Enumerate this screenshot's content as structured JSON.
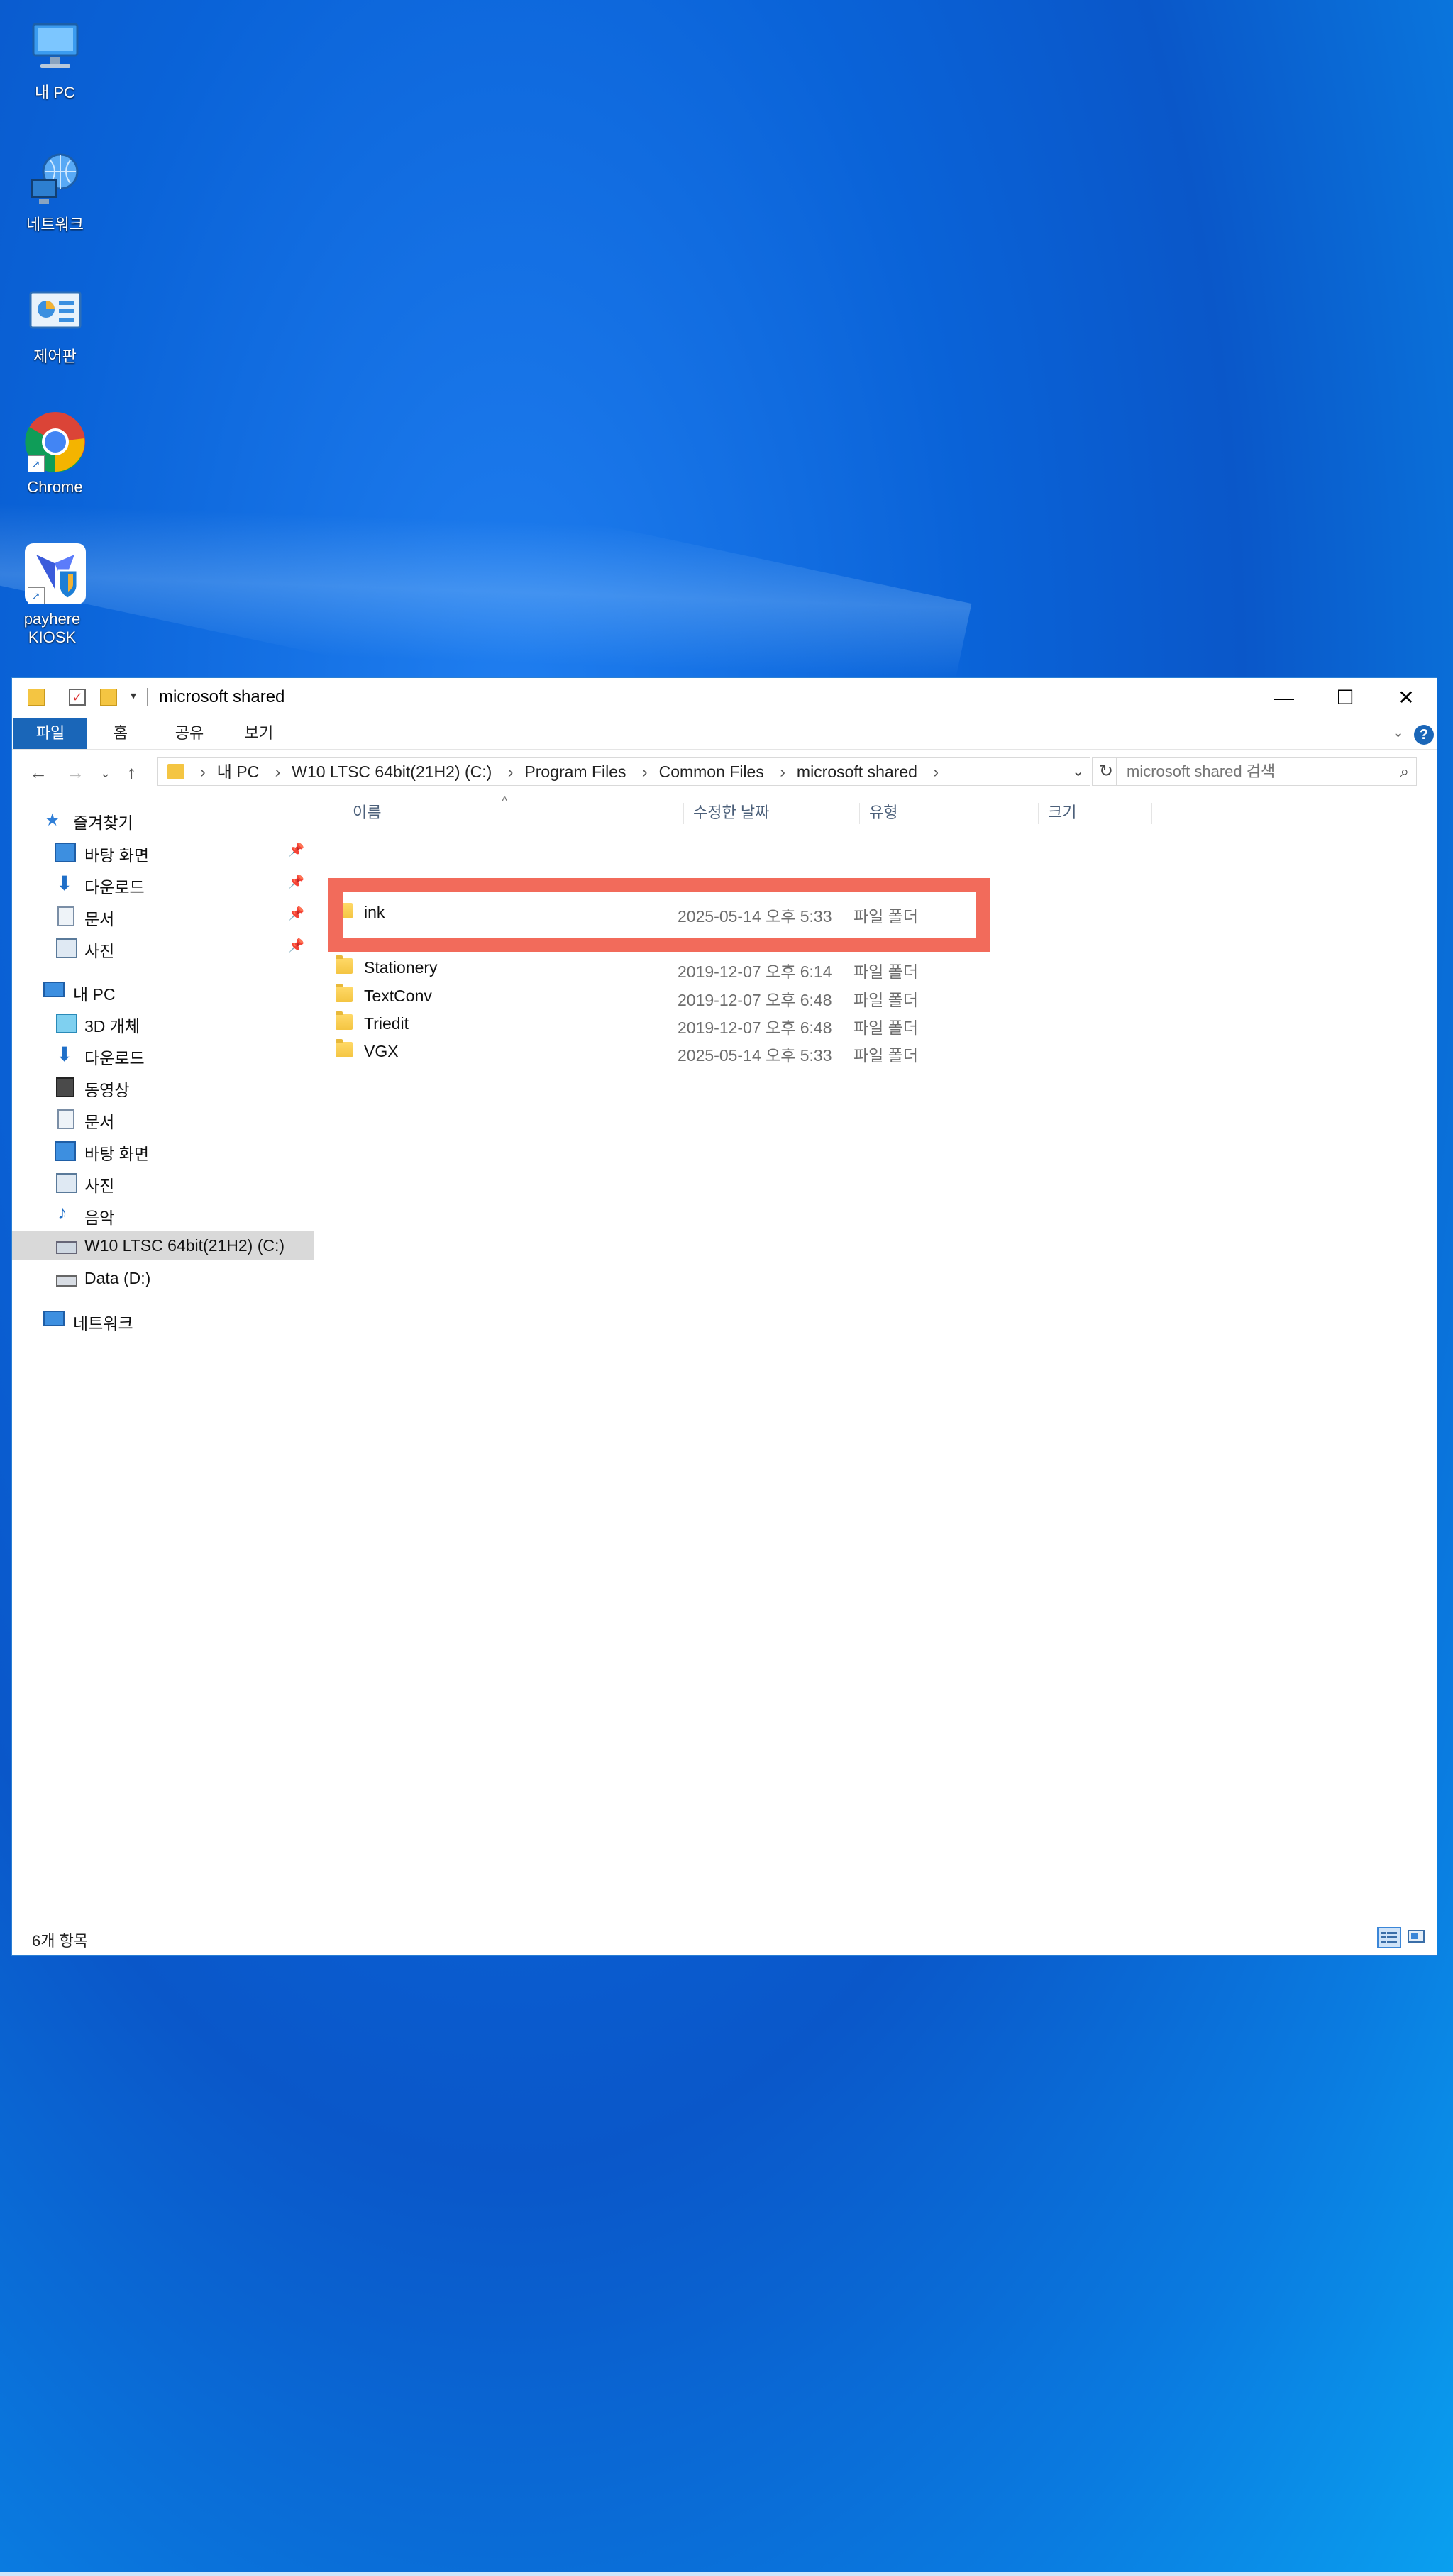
{
  "desktop": {
    "icons": [
      {
        "label": "내 PC"
      },
      {
        "label": "네트워크"
      },
      {
        "label": "제어판"
      },
      {
        "label": "Chrome"
      },
      {
        "label": "payhere KIOSK"
      }
    ]
  },
  "window": {
    "title": "microsoft shared",
    "ribbon_tabs": [
      "파일",
      "홈",
      "공유",
      "보기"
    ],
    "help": "?",
    "breadcrumb": [
      "내 PC",
      "W10 LTSC 64bit(21H2) (C:)",
      "Program Files",
      "Common Files",
      "microsoft shared"
    ],
    "search_placeholder": "microsoft shared 검색",
    "sidebar": [
      {
        "label": "즐겨찾기",
        "pin": false,
        "sel": false
      },
      {
        "label": "바탕 화면",
        "pin": true,
        "sel": false
      },
      {
        "label": "다운로드",
        "pin": true,
        "sel": false
      },
      {
        "label": "문서",
        "pin": true,
        "sel": false
      },
      {
        "label": "사진",
        "pin": true,
        "sel": false
      },
      {
        "label": "내 PC",
        "pin": false,
        "sel": false
      },
      {
        "label": "3D 개체",
        "pin": false,
        "sel": false
      },
      {
        "label": "다운로드",
        "pin": false,
        "sel": false
      },
      {
        "label": "동영상",
        "pin": false,
        "sel": false
      },
      {
        "label": "문서",
        "pin": false,
        "sel": false
      },
      {
        "label": "바탕 화면",
        "pin": false,
        "sel": false
      },
      {
        "label": "사진",
        "pin": false,
        "sel": false
      },
      {
        "label": "음악",
        "pin": false,
        "sel": false
      },
      {
        "label": "W10 LTSC 64bit(21H2) (C:)",
        "pin": false,
        "sel": true
      },
      {
        "label": "Data (D:)",
        "pin": false,
        "sel": false
      },
      {
        "label": "네트워크",
        "pin": false,
        "sel": false
      }
    ],
    "columns": [
      "이름",
      "수정한 날짜",
      "유형",
      "크기"
    ],
    "files": [
      {
        "name": "ink",
        "date": "2025-05-14 오후 5:33",
        "type": "파일 폴더"
      },
      {
        "name": "Stationery",
        "date": "2019-12-07 오후 6:14",
        "type": "파일 폴더"
      },
      {
        "name": "TextConv",
        "date": "2019-12-07 오후 6:48",
        "type": "파일 폴더"
      },
      {
        "name": "Triedit",
        "date": "2019-12-07 오후 6:48",
        "type": "파일 폴더"
      },
      {
        "name": "VGX",
        "date": "2025-05-14 오후 5:33",
        "type": "파일 폴더"
      }
    ],
    "status": "6개 항목"
  },
  "colors": {
    "accent": "#1a66b8",
    "highlight": "#f26b5b",
    "folder": "#f4c542"
  }
}
